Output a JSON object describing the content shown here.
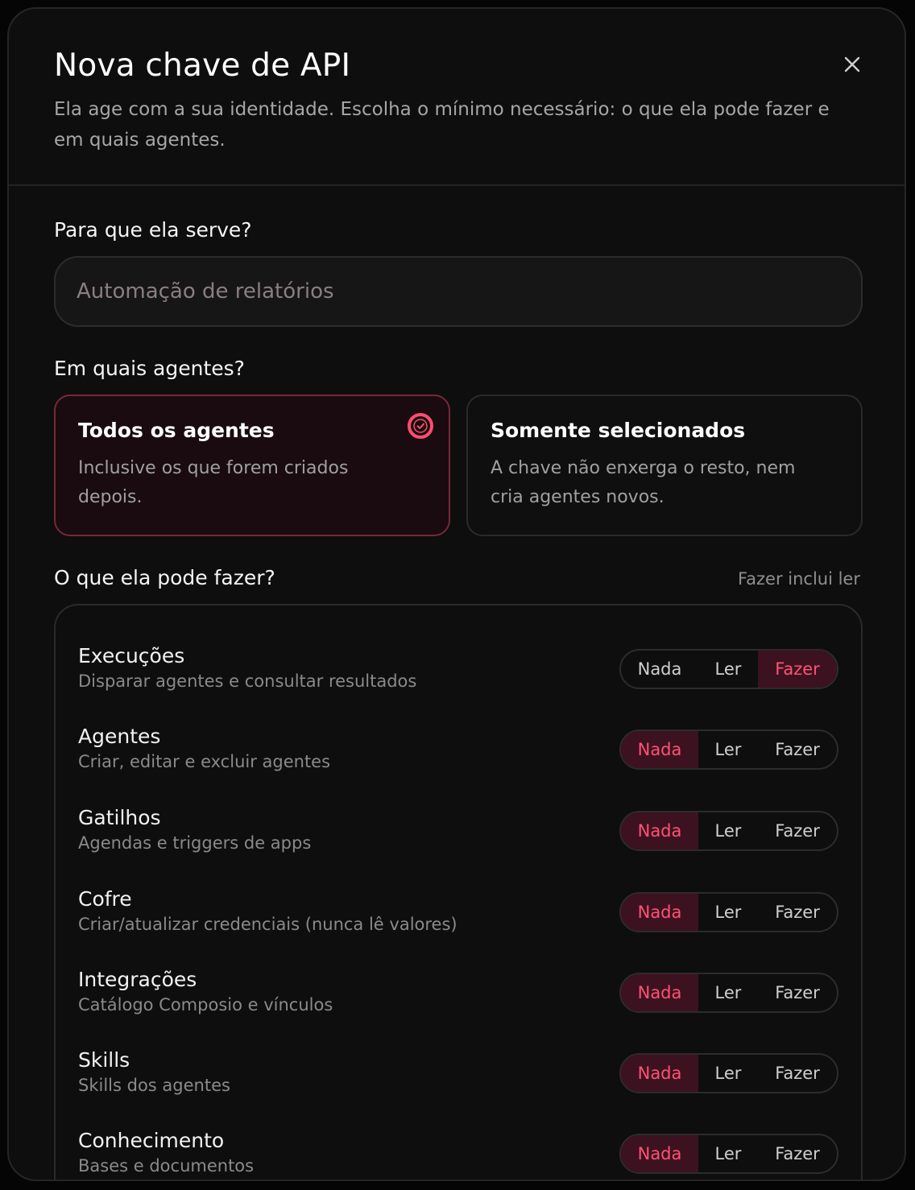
{
  "modal": {
    "title": "Nova chave de API",
    "subtitle": "Ela age com a sua identidade. Escolha o mínimo necessário: o que ela pode fazer e em quais agentes."
  },
  "purpose": {
    "label": "Para que ela serve?",
    "placeholder": "Automação de relatórios",
    "value": ""
  },
  "scope": {
    "label": "Em quais agentes?",
    "options": [
      {
        "title": "Todos os agentes",
        "description": "Inclusive os que forem criados depois.",
        "selected": true
      },
      {
        "title": "Somente selecionados",
        "description": "A chave não enxerga o resto, nem cria agentes novos.",
        "selected": false
      }
    ]
  },
  "permissions": {
    "label": "O que ela pode fazer?",
    "hint": "Fazer inclui ler",
    "levels": [
      "Nada",
      "Ler",
      "Fazer"
    ],
    "rows": [
      {
        "name": "Execuções",
        "description": "Disparar agentes e consultar resultados",
        "level": "Fazer"
      },
      {
        "name": "Agentes",
        "description": "Criar, editar e excluir agentes",
        "level": "Nada"
      },
      {
        "name": "Gatilhos",
        "description": "Agendas e triggers de apps",
        "level": "Nada"
      },
      {
        "name": "Cofre",
        "description": "Criar/atualizar credenciais (nunca lê valores)",
        "level": "Nada"
      },
      {
        "name": "Integrações",
        "description": "Catálogo Composio e vínculos",
        "level": "Nada"
      },
      {
        "name": "Skills",
        "description": "Skills dos agentes",
        "level": "Nada"
      },
      {
        "name": "Conhecimento",
        "description": "Bases e documentos",
        "level": "Nada"
      }
    ]
  },
  "colors": {
    "accent": "#ff4d72",
    "accent_bg": "#3d1220",
    "background": "#0e0e0e"
  },
  "icons": {
    "close": "close-icon",
    "selected": "check-circle-icon"
  }
}
